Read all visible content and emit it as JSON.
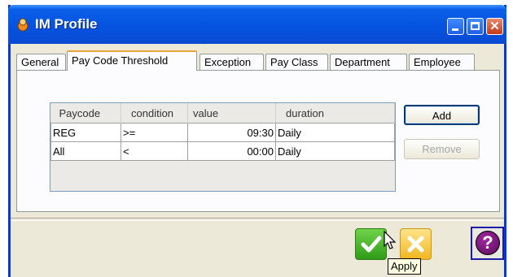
{
  "window": {
    "title": "IM Profile"
  },
  "tabs": [
    {
      "label": "General"
    },
    {
      "label": "Pay Code Threshold"
    },
    {
      "label": "Exception"
    },
    {
      "label": "Pay Class"
    },
    {
      "label": "Department"
    },
    {
      "label": "Employee"
    }
  ],
  "active_tab": "Pay Code Threshold",
  "table": {
    "headers": [
      "Paycode",
      "condition",
      "value",
      "duration"
    ],
    "rows": [
      [
        "REG",
        ">=",
        "09:30",
        "Daily"
      ],
      [
        "All",
        "<",
        "00:00",
        "Daily"
      ]
    ]
  },
  "buttons": {
    "add": "Add",
    "remove": "Remove"
  },
  "tooltip": "Apply",
  "icons": {
    "ok": "checkmark-icon",
    "cancel": "x-icon",
    "help": "question-icon",
    "app": "flame-icon"
  },
  "colors": {
    "titlebar": "#0553e0",
    "ok": "#3fb020",
    "cancel": "#f5c533",
    "help": "#7a1a7a"
  }
}
